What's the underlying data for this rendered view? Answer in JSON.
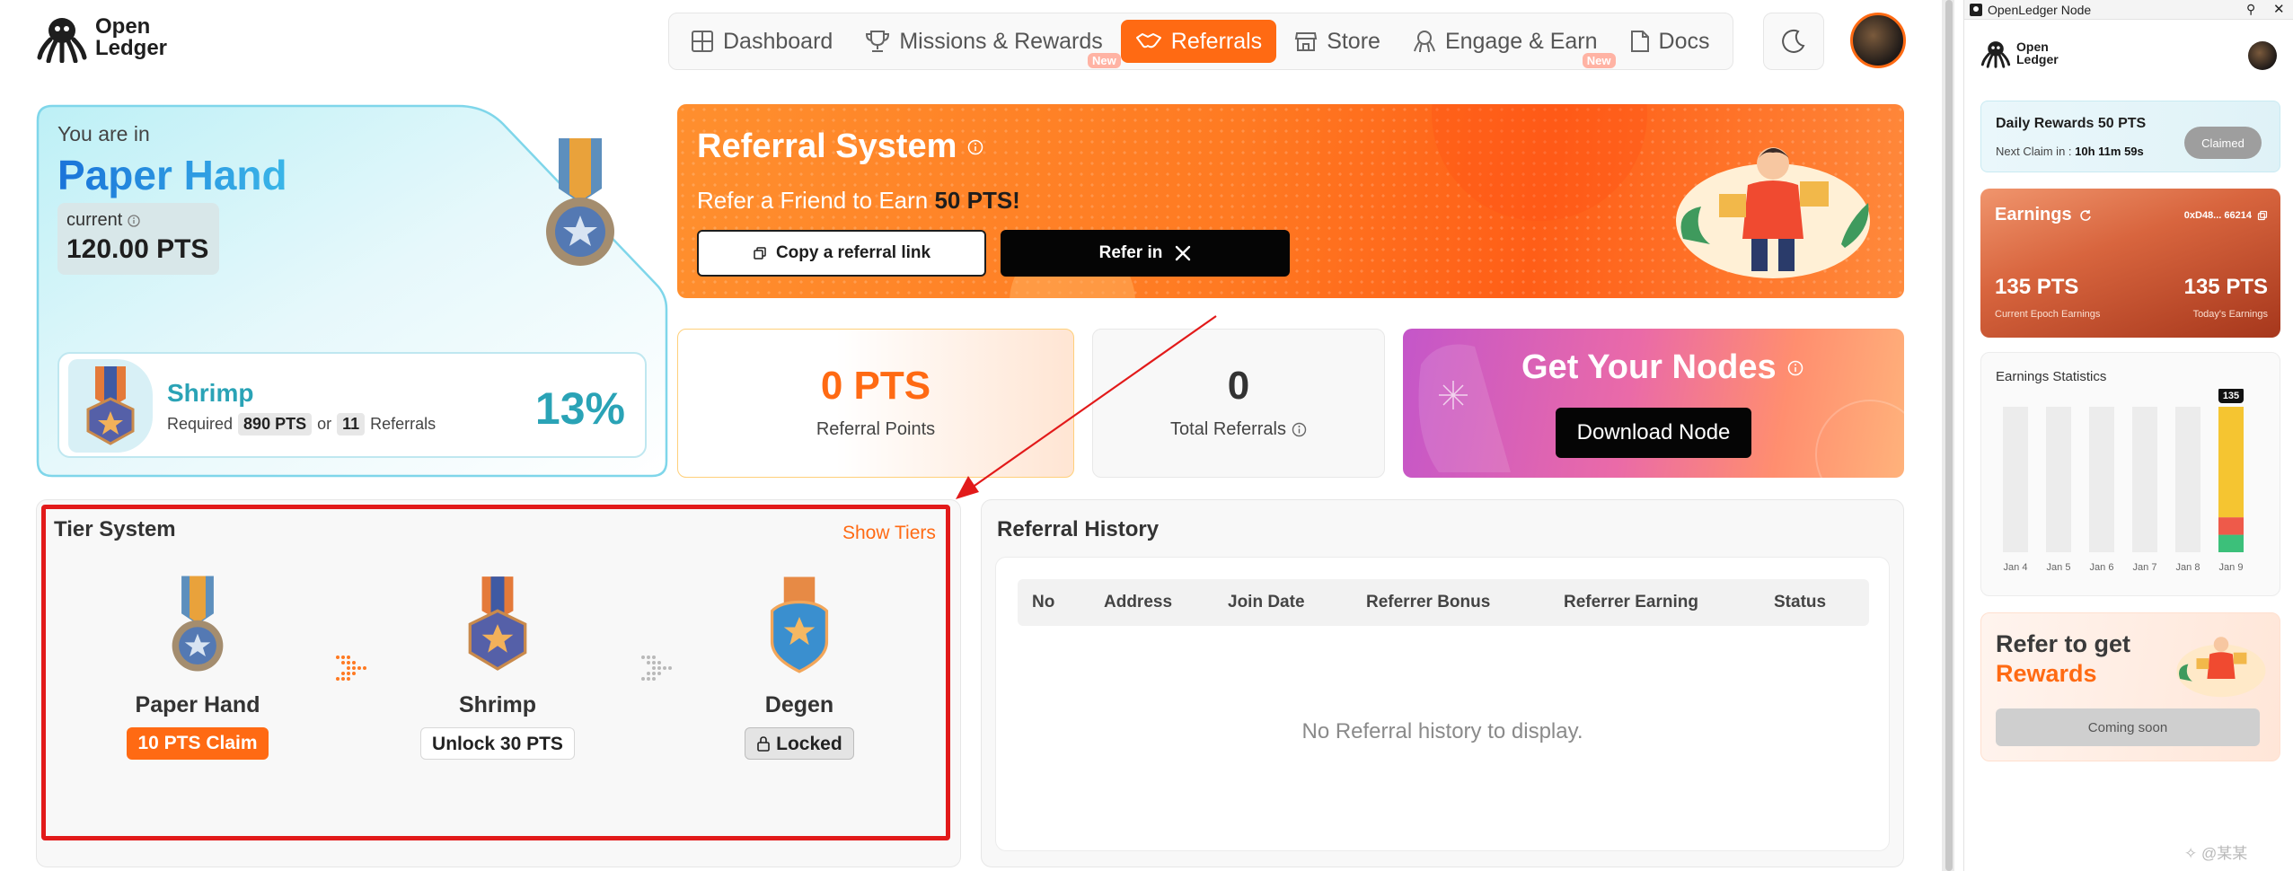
{
  "app": {
    "logo": {
      "line1": "Open",
      "line2": "Ledger"
    },
    "nav": [
      {
        "label": "Dashboard",
        "icon": "grid-icon",
        "active": false
      },
      {
        "label": "Missions & Rewards",
        "icon": "trophy-icon",
        "active": false,
        "badge": "New"
      },
      {
        "label": "Referrals",
        "icon": "handshake-icon",
        "active": true
      },
      {
        "label": "Store",
        "icon": "store-icon",
        "active": false
      },
      {
        "label": "Engage & Earn",
        "icon": "octopus-icon",
        "active": false,
        "badge": "New"
      },
      {
        "label": "Docs",
        "icon": "doc-icon",
        "active": false
      }
    ],
    "theme_icon": "moon-icon",
    "colors": {
      "accent": "#ff6a13",
      "teal": "#2aa3b6",
      "annotation": "#e21a1a"
    }
  },
  "rank": {
    "you_are_in": "You are in",
    "tier": "Paper Hand",
    "current_label": "current",
    "current_value": "120.00 PTS",
    "next": {
      "name": "Shrimp",
      "required_label": "Required",
      "required_pts": "890 PTS",
      "or": "or",
      "required_refs": "11",
      "refs_label": "Referrals",
      "progress": "13%"
    }
  },
  "banner": {
    "title": "Referral System",
    "subtitle_pre": "Refer a Friend to Earn ",
    "subtitle_pts": "50 PTS!",
    "copy_label": "Copy a referral link",
    "refer_label": "Refer in"
  },
  "stats": {
    "points_value": "0 PTS",
    "points_label": "Referral Points",
    "referrals_value": "0",
    "referrals_label": "Total Referrals"
  },
  "nodes": {
    "title": "Get Your Nodes",
    "button": "Download Node"
  },
  "tiers": {
    "title": "Tier System",
    "show": "Show Tiers",
    "items": [
      {
        "name": "Paper Hand",
        "action": "10 PTS Claim"
      },
      {
        "name": "Shrimp",
        "action": "Unlock 30 PTS"
      },
      {
        "name": "Degen",
        "action": "Locked"
      }
    ]
  },
  "history": {
    "title": "Referral History",
    "columns": [
      "No",
      "Address",
      "Join Date",
      "Referrer Bonus",
      "Referrer Earning",
      "Status"
    ],
    "empty": "No Referral history to display."
  },
  "side": {
    "window_title": "OpenLedger Node",
    "logo": {
      "line1": "Open",
      "line2": "Ledger"
    },
    "daily_title": "Daily Rewards 50 PTS",
    "next_claim_label": "Next Claim in : ",
    "next_claim_value": "10h 11m 59s",
    "claimed": "Claimed",
    "earnings_title": "Earnings",
    "address": "0xD48... 66214",
    "epoch_value": "135 PTS",
    "epoch_label": "Current Epoch Earnings",
    "today_value": "135 PTS",
    "today_label": "Today's Earnings",
    "stats_title": "Earnings Statistics",
    "chart_data": {
      "type": "bar",
      "categories": [
        "Jan 4",
        "Jan 5",
        "Jan 6",
        "Jan 7",
        "Jan 8",
        "Jan 9"
      ],
      "values": [
        0,
        0,
        0,
        0,
        0,
        135
      ],
      "data_labels": [
        "",
        "",
        "",
        "",
        "",
        "135"
      ]
    },
    "refer_line1": "Refer to get",
    "refer_line2": "Rewards",
    "coming_soon": "Coming soon"
  },
  "watermark": "✧ @某某"
}
